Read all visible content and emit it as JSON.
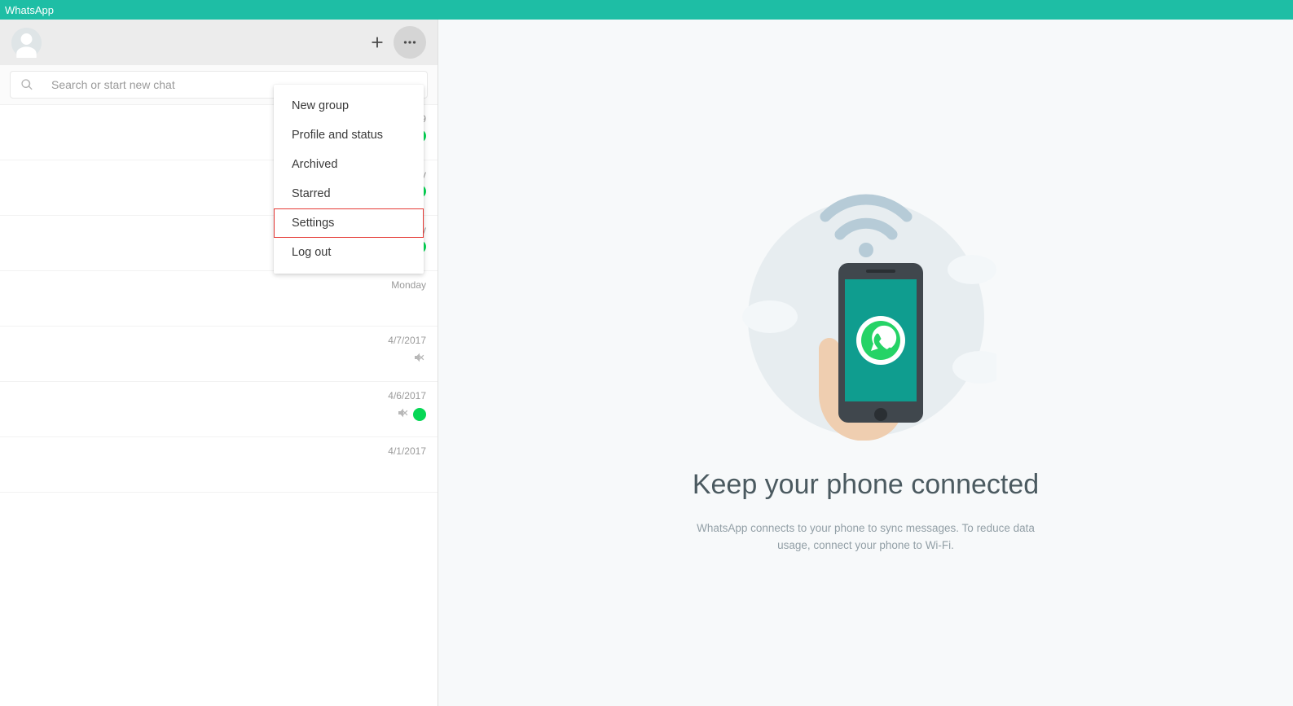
{
  "titlebar": {
    "app_name": "WhatsApp"
  },
  "search": {
    "placeholder": "Search or start new chat"
  },
  "menu": {
    "items": [
      {
        "label": "New group"
      },
      {
        "label": "Profile and status"
      },
      {
        "label": "Archived"
      },
      {
        "label": "Starred"
      },
      {
        "label": "Settings",
        "highlighted": true
      },
      {
        "label": "Log out"
      }
    ]
  },
  "chats": [
    {
      "time_tail": "9",
      "unread": true,
      "muted": false
    },
    {
      "time_tail": "y",
      "unread": true,
      "muted": false
    },
    {
      "time_tail": "y",
      "unread": true,
      "muted": false
    },
    {
      "time": "Monday",
      "unread": false,
      "muted": false
    },
    {
      "time": "4/7/2017",
      "unread": false,
      "muted": true
    },
    {
      "time": "4/6/2017",
      "unread": true,
      "muted": true
    },
    {
      "time": "4/1/2017",
      "unread": false,
      "muted": false
    }
  ],
  "landing": {
    "title": "Keep your phone connected",
    "subtitle": "WhatsApp connects to your phone to sync messages. To reduce data usage, connect your phone to Wi-Fi."
  },
  "colors": {
    "brand": "#1ebea5",
    "unread": "#06d755",
    "highlight_border": "#e53935"
  }
}
